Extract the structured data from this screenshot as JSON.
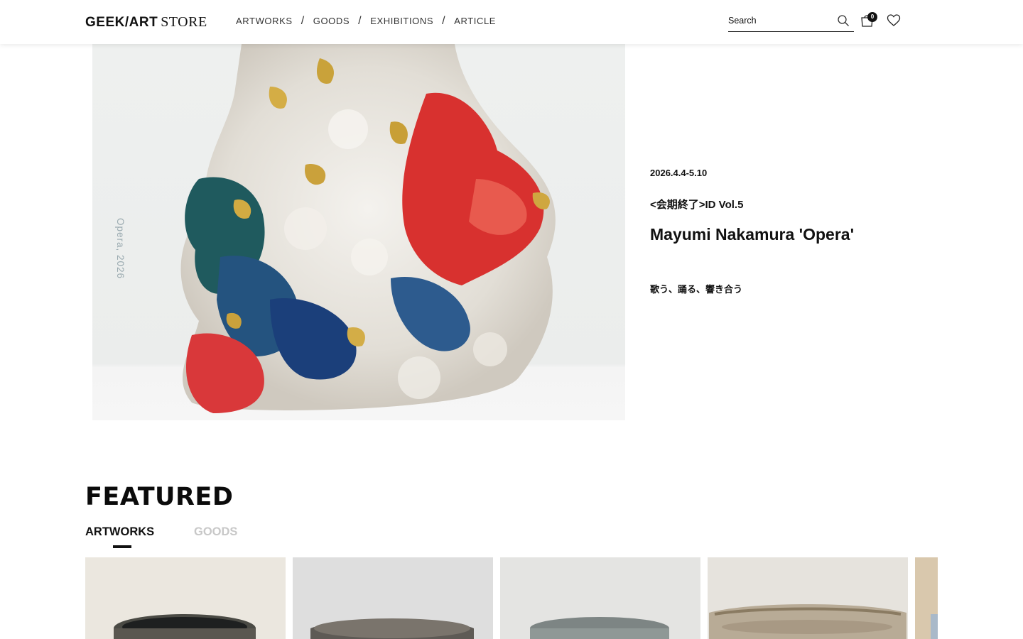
{
  "header": {
    "logo_main": "GEEK/ART",
    "logo_sub": "STORE",
    "nav": [
      "ARTWORKS",
      "GOODS",
      "EXHIBITIONS",
      "ARTICLE"
    ],
    "nav_separator": "/",
    "search_placeholder": "Search",
    "cart_count": "0",
    "icons": [
      "search-icon",
      "cart-icon",
      "heart-icon"
    ]
  },
  "hero": {
    "image_caption": "Opera, 2026",
    "date": "2026.4.4-5.10",
    "series": "<会期終了>ID Vol.5",
    "title": "Mayumi Nakamura 'Opera'",
    "subtitle": "歌う、踊る、響き合う"
  },
  "featured": {
    "title": "FEATURED",
    "tabs": [
      "ARTWORKS",
      "GOODS"
    ],
    "active_tab": "ARTWORKS"
  },
  "colors": {
    "text": "#111111",
    "inactive_tab": "#c8c8c8",
    "caption": "#9aaab0"
  }
}
